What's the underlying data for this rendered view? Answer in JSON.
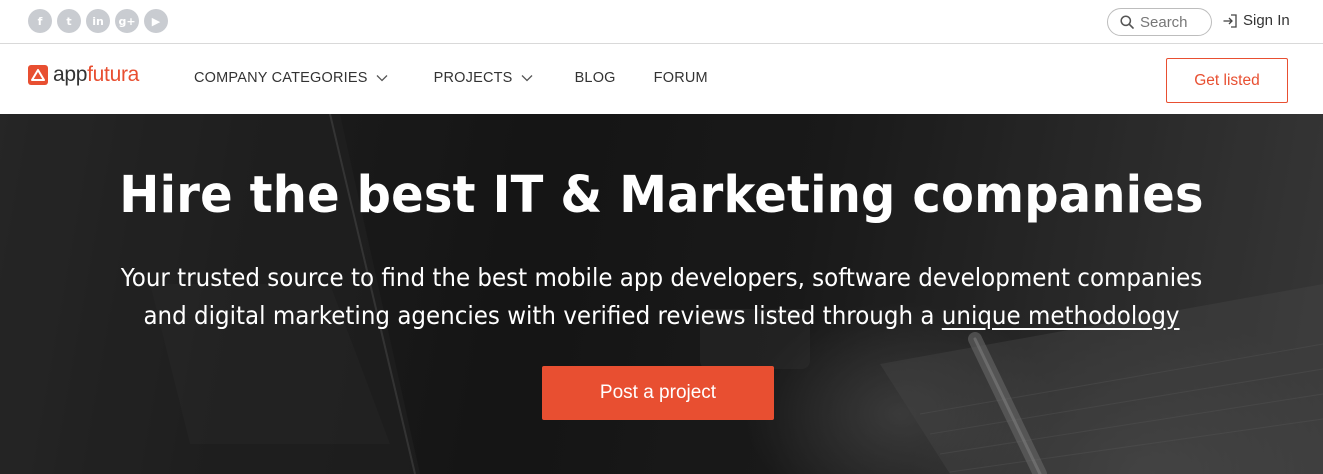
{
  "colors": {
    "accent": "#e84f31",
    "social_icon_bg": "#c9ccd1",
    "hero_text": "#ffffff"
  },
  "topbar": {
    "social": [
      {
        "name": "facebook",
        "glyph": "f"
      },
      {
        "name": "twitter",
        "glyph": "t"
      },
      {
        "name": "linkedin",
        "glyph": "in"
      },
      {
        "name": "google-plus",
        "glyph": "g+"
      },
      {
        "name": "youtube",
        "glyph": "▶"
      }
    ],
    "search": {
      "placeholder": "Search",
      "icon": "search-icon"
    },
    "signin": {
      "label": "Sign In",
      "icon": "sign-in-icon"
    }
  },
  "nav": {
    "logo": {
      "part1": "app",
      "part2": "futura"
    },
    "items": [
      {
        "label": "COMPANY CATEGORIES",
        "has_dropdown": true
      },
      {
        "label": "PROJECTS",
        "has_dropdown": true
      },
      {
        "label": "BLOG",
        "has_dropdown": false
      },
      {
        "label": "FORUM",
        "has_dropdown": false
      }
    ],
    "cta": "Get listed"
  },
  "hero": {
    "title": "Hire the best IT & Marketing companies",
    "subtitle_line1": "Your trusted source to find the best mobile app developers, software development companies",
    "subtitle_line2_prefix": "and digital marketing agencies with verified reviews listed through a",
    "subtitle_link": "unique methodology",
    "cta": "Post a project"
  }
}
